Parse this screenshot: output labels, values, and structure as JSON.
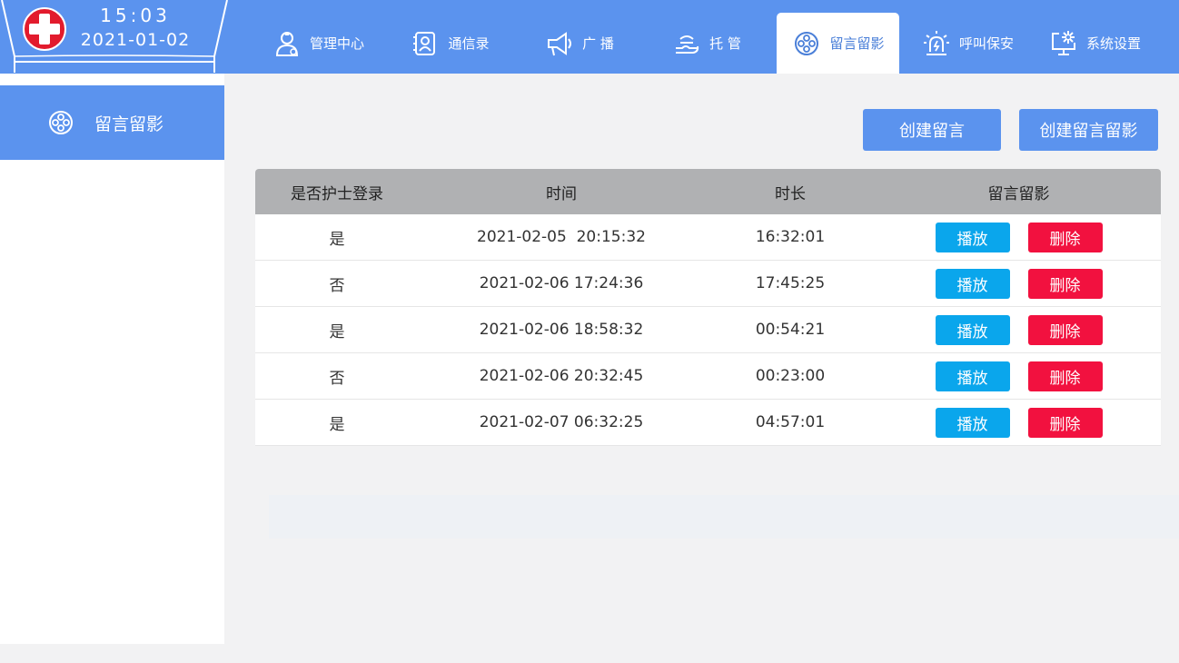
{
  "header": {
    "time": "15:03",
    "date": "2021-01-02",
    "nav": [
      {
        "label": "管理中心",
        "icon": "doctor-icon"
      },
      {
        "label": "通信录",
        "icon": "contacts-icon"
      },
      {
        "label": "广  播",
        "icon": "megaphone-icon"
      },
      {
        "label": "托  管",
        "icon": "hand-icon"
      },
      {
        "label": "留言留影",
        "icon": "film-reel-icon",
        "active": true
      },
      {
        "label": "呼叫保安",
        "icon": "alarm-icon"
      },
      {
        "label": "系统设置",
        "icon": "monitor-settings-icon"
      }
    ]
  },
  "sidebar": {
    "items": [
      {
        "label": "留言留影",
        "icon": "film-reel-icon"
      }
    ]
  },
  "actions": {
    "create_message": "创建留言",
    "create_video_message": "创建留言留影"
  },
  "table": {
    "columns": [
      "是否护士登录",
      "时间",
      "时长",
      "留言留影"
    ],
    "play_label": "播放",
    "delete_label": "删除",
    "rows": [
      {
        "nurse": "是",
        "time": "2021-02-05  20:15:32",
        "duration": "16:32:01"
      },
      {
        "nurse": "否",
        "time": "2021-02-06 17:24:36",
        "duration": "17:45:25"
      },
      {
        "nurse": "是",
        "time": "2021-02-06 18:58:32",
        "duration": "00:54:21"
      },
      {
        "nurse": "否",
        "time": "2021-02-06 20:32:45",
        "duration": "00:23:00"
      },
      {
        "nurse": "是",
        "time": "2021-02-07 06:32:25",
        "duration": "04:57:01"
      }
    ]
  },
  "colors": {
    "header_blue": "#5b93ee",
    "play_blue": "#0aa6ec",
    "delete_red": "#f2113f",
    "header_gray": "#b0b1b3"
  }
}
